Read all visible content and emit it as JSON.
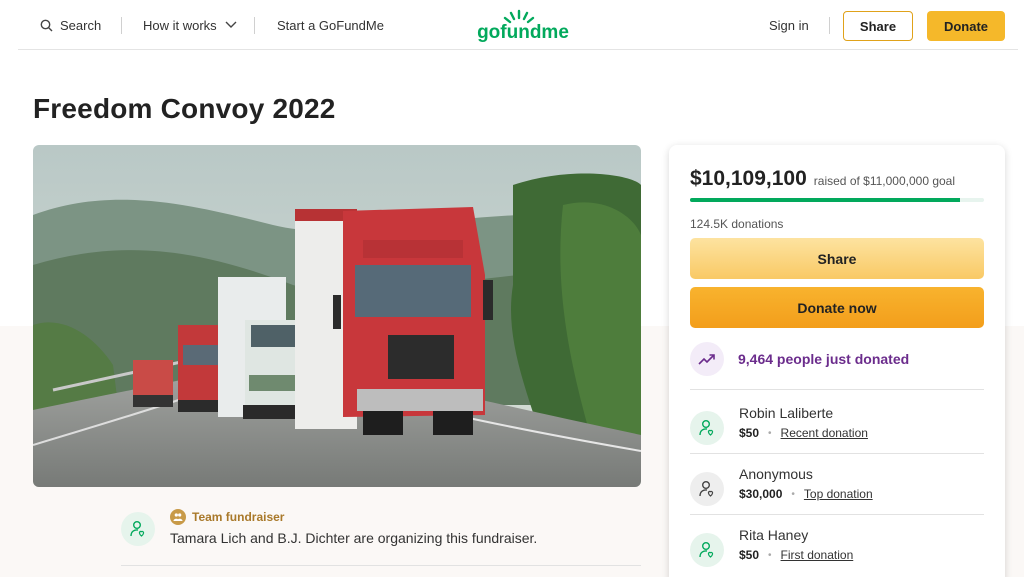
{
  "header": {
    "search_label": "Search",
    "how_it_works_label": "How it works",
    "start_label": "Start a GoFundMe",
    "logo_text": "gofundme",
    "signin_label": "Sign in",
    "share_label": "Share",
    "donate_label": "Donate"
  },
  "campaign": {
    "title": "Freedom Convoy 2022",
    "hero_image": "red-trucks-convoy-photo"
  },
  "organizer": {
    "badge_label": "Team fundraiser",
    "text": "Tamara Lich and B.J. Dichter are organizing this fundraiser."
  },
  "summary": {
    "raised": "$10,109,100",
    "goal_text": "raised of $11,000,000 goal",
    "progress_fraction": 0.919,
    "donations_count": "124.5K donations",
    "share_label": "Share",
    "donate_label": "Donate now",
    "trend_text": "9,464 people just donated"
  },
  "donors": [
    {
      "name": "Robin Laliberte",
      "amount": "$50",
      "tag": "Recent donation",
      "avatar_color": "#e6f4ec"
    },
    {
      "name": "Anonymous",
      "amount": "$30,000",
      "tag": "Top donation",
      "avatar_color": "#eeeeee"
    },
    {
      "name": "Rita Haney",
      "amount": "$50",
      "tag": "First donation",
      "avatar_color": "#e6f4ec"
    }
  ],
  "colors": {
    "brand_green": "#02a95c",
    "accent_yellow": "#f5b82a",
    "trend_purple": "#6b2c8c",
    "badge_gold": "#a9792a"
  }
}
